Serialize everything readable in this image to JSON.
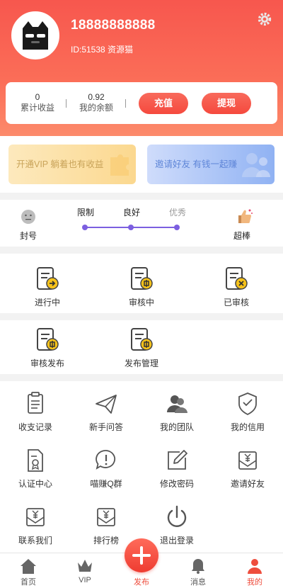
{
  "profile": {
    "phone": "18888888888",
    "id_line": "ID:51538 资源猫",
    "avatar_icon": "cat-avatar-icon",
    "settings_icon": "gear-icon"
  },
  "stats": {
    "total_earnings_value": "0",
    "total_earnings_label": "累计收益",
    "balance_value": "0.92",
    "balance_label": "我的余额",
    "recharge_label": "充值",
    "withdraw_label": "提现"
  },
  "promos": {
    "vip": "开通VIP 躺着也有收益",
    "invite": "邀请好友 有钱一起赚"
  },
  "credit": {
    "left_label": "封号",
    "right_label": "超棒",
    "levels": [
      "限制",
      "良好",
      "优秀"
    ],
    "colors": {
      "track": "#7c5fe0",
      "muted": "#9a9a9a"
    }
  },
  "task_section": {
    "items": [
      {
        "label": "进行中",
        "icon": "task-in-progress-icon"
      },
      {
        "label": "审核中",
        "icon": "task-reviewing-icon"
      },
      {
        "label": "已审核",
        "icon": "task-reviewed-icon"
      }
    ]
  },
  "publish_section": {
    "items": [
      {
        "label": "审核发布",
        "icon": "review-publish-icon"
      },
      {
        "label": "发布管理",
        "icon": "publish-manage-icon"
      }
    ]
  },
  "menu": {
    "items": [
      {
        "label": "收支记录",
        "icon": "clipboard-icon"
      },
      {
        "label": "新手问答",
        "icon": "paper-plane-icon"
      },
      {
        "label": "我的团队",
        "icon": "team-icon"
      },
      {
        "label": "我的信用",
        "icon": "shield-icon"
      },
      {
        "label": "认证中心",
        "icon": "certificate-icon"
      },
      {
        "label": "喵赚Q群",
        "icon": "exclamation-bubble-icon"
      },
      {
        "label": "修改密码",
        "icon": "edit-icon"
      },
      {
        "label": "邀请好友",
        "icon": "yuan-envelope-icon"
      },
      {
        "label": "联系我们",
        "icon": "yuan-envelope-icon"
      },
      {
        "label": "排行榜",
        "icon": "yuan-envelope-icon"
      },
      {
        "label": "退出登录",
        "icon": "power-icon"
      }
    ]
  },
  "tabbar": {
    "items": [
      {
        "label": "首页",
        "icon": "home-icon"
      },
      {
        "label": "VIP",
        "icon": "crown-icon"
      },
      {
        "label": "发布",
        "icon": "plus-icon"
      },
      {
        "label": "消息",
        "icon": "bell-icon"
      },
      {
        "label": "我的",
        "icon": "user-icon"
      }
    ],
    "active_index": 4,
    "accent": "#ee4d3d"
  },
  "colors": {
    "header": "#f7574e",
    "accent": "#f5493e",
    "coin": "#f6c21a"
  }
}
